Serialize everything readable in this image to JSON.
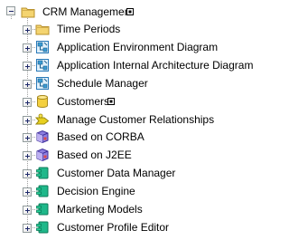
{
  "root": {
    "label": "CRM Management"
  },
  "children": [
    {
      "label": "Time Periods",
      "icon": "folder-icon"
    },
    {
      "label": "Application Environment Diagram",
      "icon": "diagram-icon"
    },
    {
      "label": "Application Internal Architecture Diagram",
      "icon": "diagram-icon"
    },
    {
      "label": "Schedule Manager",
      "icon": "diagram-icon"
    },
    {
      "label": "Customers",
      "icon": "database-icon"
    },
    {
      "label": "Manage Customer Relationships",
      "icon": "process-icon"
    },
    {
      "label": "Based on CORBA",
      "icon": "package-icon"
    },
    {
      "label": "Based on J2EE",
      "icon": "package-icon"
    },
    {
      "label": "Customer Data Manager",
      "icon": "component-icon"
    },
    {
      "label": "Decision Engine",
      "icon": "component-icon"
    },
    {
      "label": "Marketing Models",
      "icon": "component-icon"
    },
    {
      "label": "Customer Profile Editor",
      "icon": "component-icon"
    }
  ],
  "colors": {
    "component": "#1fb88a",
    "folder": "#f4d470",
    "diagram": "#3a9bd1",
    "process": "#e8d020",
    "package": "#6a55c9"
  }
}
